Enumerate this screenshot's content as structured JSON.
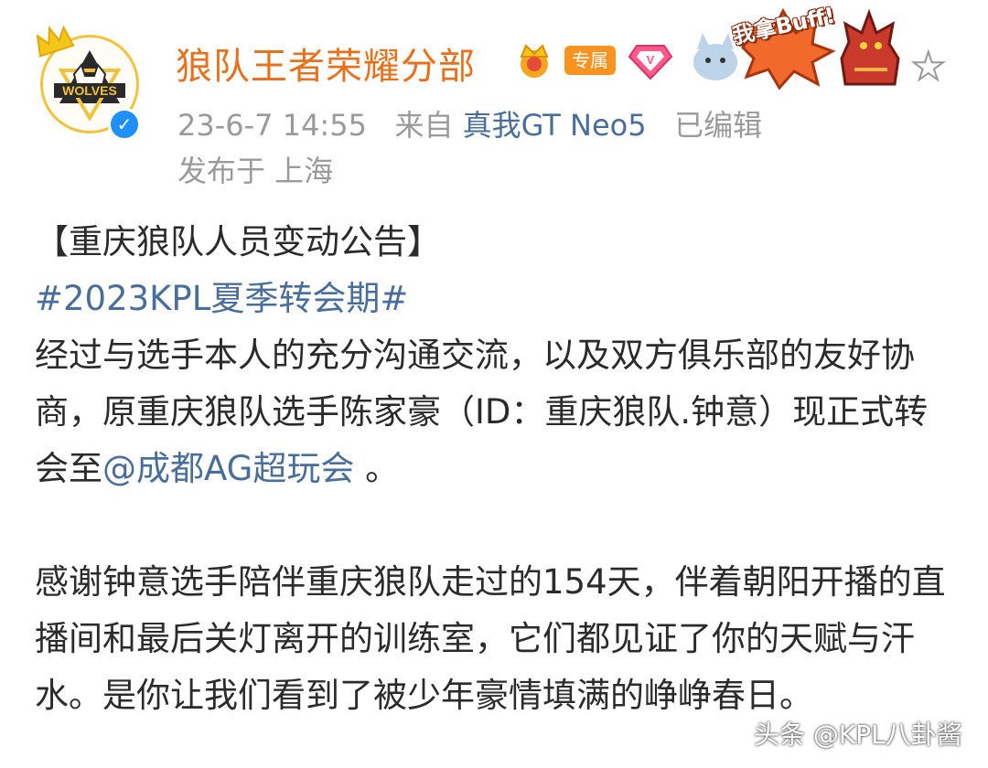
{
  "post": {
    "username": "狼队王者荣耀分部",
    "badge_exclusive": "专属",
    "fan_card_text": "我拿Buff!",
    "avatar_text": "WOLVES",
    "timestamp": "23-6-7 14:55",
    "from_label": "来自",
    "device": "真我GT Neo5",
    "edited": "已编辑",
    "location": "发布于 上海"
  },
  "content": {
    "title": "【重庆狼队人员变动公告】",
    "hashtag": "#2023KPL夏季转会期#",
    "para1_before": "经过与选手本人的充分沟通交流，以及双方俱乐部的友好协商，原重庆狼队选手陈家豪（ID：重庆狼队.钟意）现正式转会至",
    "mention": "@成都AG超玩会",
    "para1_after": " 。",
    "para2": "感谢钟意选手陪伴重庆狼队走过的154天，伴着朝阳开播的直播间和最后关灯离开的训练室，它们都见证了你的天赋与汗水。是你让我们看到了被少年豪情填满的峥峥春日。"
  },
  "watermark": "头条 @KPL八卦酱",
  "icons": {
    "avatar_crown": "crown-icon",
    "verified": "verified-check-icon",
    "member_crown": "member-crown-icon",
    "diamond": "diamond-vip-icon",
    "star": "star-icon"
  },
  "colors": {
    "username": "#e8711e",
    "link": "#4a6e9a",
    "meta": "#9a9a9a",
    "verified": "#1e90ff",
    "exclusive_badge": "#f7931e"
  }
}
